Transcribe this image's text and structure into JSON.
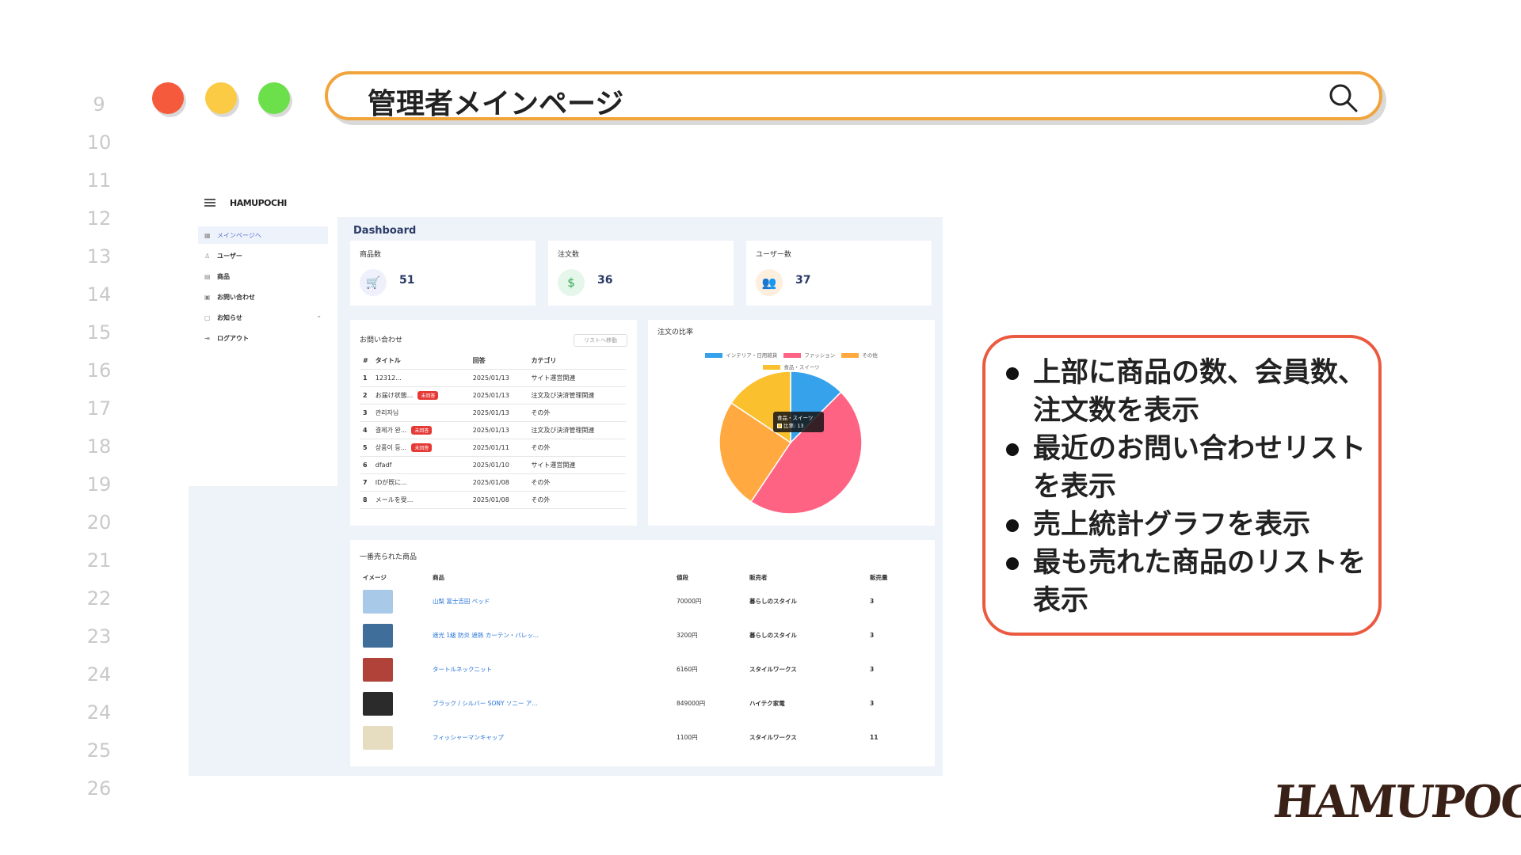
{
  "line_numbers": [
    "9",
    "10",
    "11",
    "12",
    "13",
    "14",
    "15",
    "16",
    "17",
    "18",
    "19",
    "20",
    "21",
    "22",
    "23",
    "24",
    "24",
    "25",
    "26"
  ],
  "title_bar": {
    "text": "管理者メインページ",
    "icon": "search-icon"
  },
  "app": {
    "logo": "HAMUPOCHI",
    "sidebar": [
      {
        "label": "メインページへ",
        "icon": "grid-icon"
      },
      {
        "label": "ユーザー",
        "icon": "user-icon"
      },
      {
        "label": "商品",
        "icon": "box-icon"
      },
      {
        "label": "お問い合わせ",
        "icon": "inbox-icon"
      },
      {
        "label": "お知らせ",
        "icon": "bell-icon"
      },
      {
        "label": "ログアウト",
        "icon": "logout-icon"
      }
    ],
    "dashboard_title": "Dashboard",
    "stats": [
      {
        "label": "商品数",
        "value": "51",
        "icon": "cart-icon"
      },
      {
        "label": "注文数",
        "value": "36",
        "icon": "dollar-icon"
      },
      {
        "label": "ユーザー数",
        "value": "37",
        "icon": "users-icon"
      }
    ],
    "inquiries": {
      "title": "お問い合わせ",
      "button": "リストへ移動",
      "columns": [
        "#",
        "タイトル",
        "回答",
        "カテゴリ"
      ],
      "rows": [
        {
          "no": "1",
          "title": "12312...",
          "badge": "",
          "date": "2025/01/13",
          "category": "サイト運営関連"
        },
        {
          "no": "2",
          "title": "お届け状態...",
          "badge": "未回答",
          "date": "2025/01/13",
          "category": "注文及び決済管理関連"
        },
        {
          "no": "3",
          "title": "관리자님",
          "badge": "",
          "date": "2025/01/13",
          "category": "その外"
        },
        {
          "no": "4",
          "title": "결제가 완...",
          "badge": "未回答",
          "date": "2025/01/13",
          "category": "注文及び決済管理関連"
        },
        {
          "no": "5",
          "title": "상품이 등...",
          "badge": "未回答",
          "date": "2025/01/11",
          "category": "その外"
        },
        {
          "no": "6",
          "title": "dfadf",
          "badge": "",
          "date": "2025/01/10",
          "category": "サイト運営関連"
        },
        {
          "no": "7",
          "title": "IDが既に...",
          "badge": "",
          "date": "2025/01/08",
          "category": "その外"
        },
        {
          "no": "8",
          "title": "メールを受...",
          "badge": "",
          "date": "2025/01/08",
          "category": "その外"
        }
      ]
    },
    "ratio_chart": {
      "title": "注文の比率",
      "tooltip": {
        "name": "食品・スイーツ",
        "line": "比率: 13"
      }
    },
    "best_sellers": {
      "title": "一番売られた商品",
      "columns": [
        "イメージ",
        "商品",
        "値段",
        "販売者",
        "販売量"
      ],
      "rows": [
        {
          "name": "山梨 富士吉田 ベッド",
          "price": "70000円",
          "seller": "暮らしのスタイル",
          "qty": "3",
          "thumb_color": "#a9c9e8"
        },
        {
          "name": "遮光 1級 防炎 遮熱 カーテン・バレッ...",
          "price": "3200円",
          "seller": "暮らしのスタイル",
          "qty": "3",
          "thumb_color": "#3f6e9a"
        },
        {
          "name": "タートルネックニット",
          "price": "6160円",
          "seller": "スタイルワークス",
          "qty": "3",
          "thumb_color": "#b0423a"
        },
        {
          "name": "ブラック / シルバー SONY ソニー ア...",
          "price": "849000円",
          "seller": "ハイテク家電",
          "qty": "3",
          "thumb_color": "#2b2b2b"
        },
        {
          "name": "フィッシャーマンキャップ",
          "price": "1100円",
          "seller": "スタイルワークス",
          "qty": "11",
          "thumb_color": "#e6dcc0"
        }
      ]
    }
  },
  "chart_data": {
    "type": "pie",
    "title": "注文の比率",
    "legend": [
      "インテリア・日用雑貨",
      "ファッション",
      "その他",
      "食品・スイーツ"
    ],
    "series": [
      {
        "name": "インテリア・日用雑貨",
        "value": 4,
        "color": "#36a2eb"
      },
      {
        "name": "ファッション",
        "value": 15,
        "color": "#ff6384"
      },
      {
        "name": "その他",
        "value": 8,
        "color": "#ffa940"
      },
      {
        "name": "食品・スイーツ",
        "value": 5,
        "color": "#fbc02d"
      }
    ]
  },
  "bubble": {
    "items": [
      "上部に商品の数、会員数、注文数を表示",
      "最近のお問い合わせリストを表示",
      "売上統計グラフを表示",
      "最も売れた商品のリストを表示"
    ]
  },
  "brand_logo": "HAMUPOCHI",
  "colors": {
    "accent_orange": "#f2a43c",
    "bubble_border": "#ea5a40",
    "link_blue": "#1f6fd8"
  }
}
